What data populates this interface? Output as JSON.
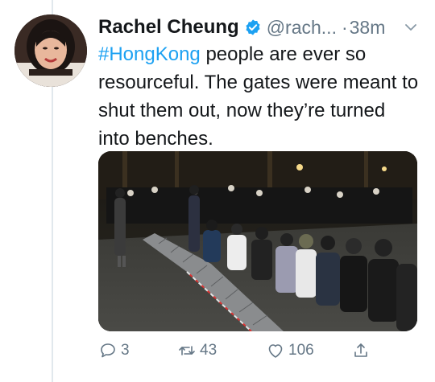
{
  "tweet": {
    "display_name": "Rachel Cheung",
    "handle": "@rach...",
    "separator": "·",
    "time": "38m",
    "hashtag": "#HongKong",
    "text_rest": " people are ever so resourceful. The gates were meant to shut them out, now they’re turned into benches."
  },
  "actions": {
    "reply_count": "3",
    "retweet_count": "43",
    "like_count": "106"
  },
  "colors": {
    "accent": "#1da1f2",
    "muted": "#657786"
  },
  "icons": [
    "verified-badge-icon",
    "chevron-down-icon",
    "reply-icon",
    "retweet-icon",
    "like-icon",
    "share-icon"
  ]
}
